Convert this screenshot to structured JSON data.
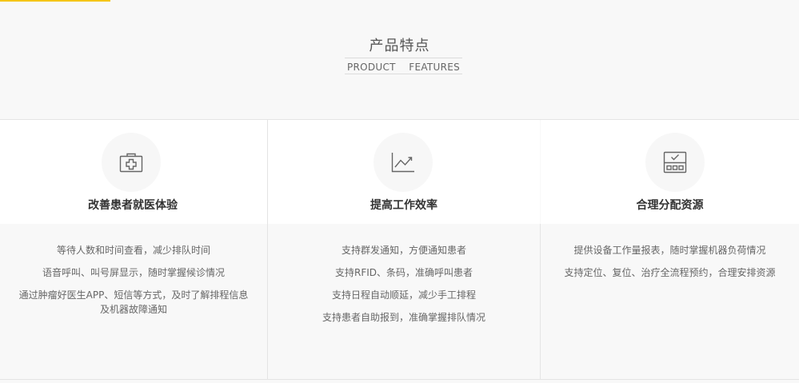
{
  "header": {
    "title": "产品特点",
    "subtitle": "PRODUCT    FEATURES"
  },
  "colors": {
    "accent": "#f5c518",
    "background": "#f8f8f8",
    "card_top": "#ffffff",
    "divider": "#e4e4e4"
  },
  "features": [
    {
      "icon": "medical-kit-icon",
      "title": "改善患者就医体验",
      "items": [
        "等待人数和时间查看，减少排队时间",
        "语音呼叫、叫号屏显示，随时掌握候诊情况",
        "通过肿瘤好医生APP、短信等方式，及时了解排程信息及机器故障通知"
      ]
    },
    {
      "icon": "trend-chart-icon",
      "title": "提高工作效率",
      "items": [
        "支持群发通知，方便通知患者",
        "支持RFID、条码，准确呼叫患者",
        "支持日程自动顺延，减少手工排程",
        "支持患者自助报到，准确掌握排队情况"
      ]
    },
    {
      "icon": "monitor-check-icon",
      "title": "合理分配资源",
      "items": [
        "提供设备工作量报表，随时掌握机器负荷情况",
        "支持定位、复位、治疗全流程预约，合理安排资源"
      ]
    }
  ]
}
